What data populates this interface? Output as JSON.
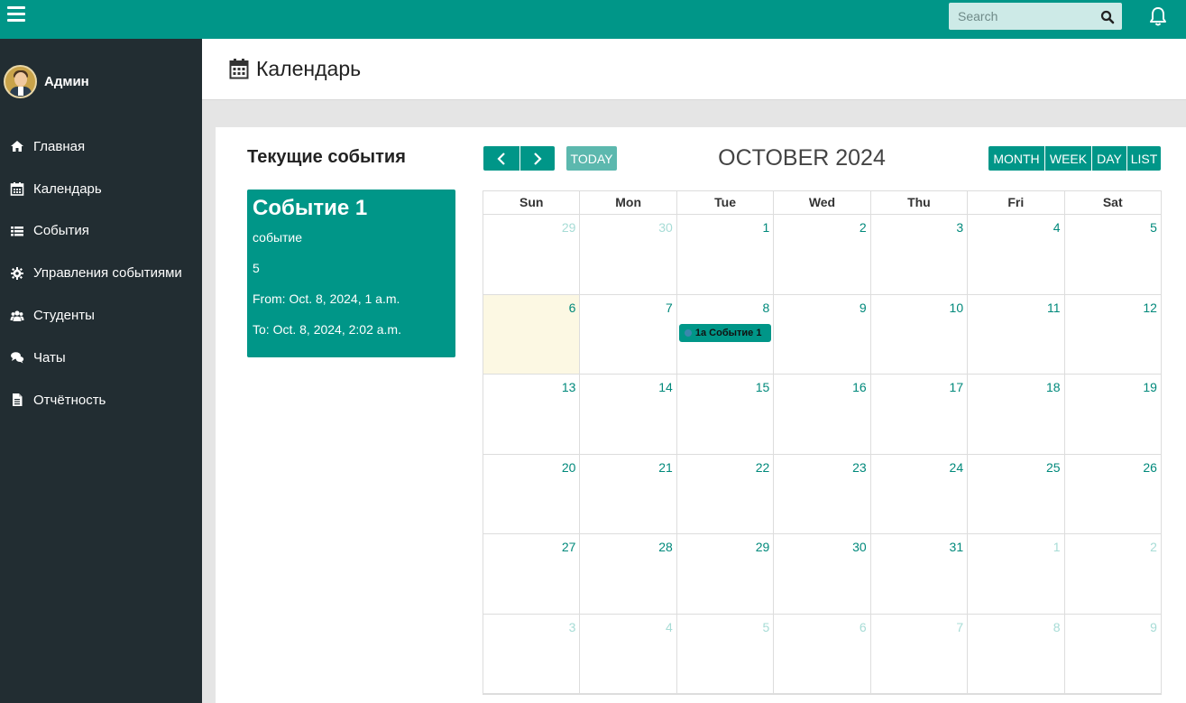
{
  "topbar": {
    "search_placeholder": "Search",
    "menu_icon": "hamburger-icon",
    "search_icon": "search-icon",
    "notifications_icon": "bell-icon",
    "color": "#009688"
  },
  "sidebar": {
    "user_name": "Админ",
    "items": [
      {
        "label": "Главная",
        "icon": "home-icon"
      },
      {
        "label": "Календарь",
        "icon": "calendar-icon"
      },
      {
        "label": "События",
        "icon": "list-icon"
      },
      {
        "label": "Управления событиями",
        "icon": "gear-icon"
      },
      {
        "label": "Студенты",
        "icon": "users-icon"
      },
      {
        "label": "Чаты",
        "icon": "chat-icon"
      },
      {
        "label": "Отчётность",
        "icon": "document-icon"
      }
    ]
  },
  "header": {
    "title": "Календарь",
    "icon": "calendar-icon"
  },
  "current_events": {
    "title": "Текущие события",
    "events": [
      {
        "title": "Событие 1",
        "description": "событие",
        "number": "5",
        "from": "From: Oct. 8, 2024, 1 a.m.",
        "to": "To: Oct. 8, 2024, 2:02 a.m."
      }
    ]
  },
  "calendar": {
    "title": "OCTOBER 2024",
    "today_label": "TODAY",
    "view_buttons": [
      "MONTH",
      "WEEK",
      "DAY",
      "LIST"
    ],
    "weekdays": [
      "Sun",
      "Mon",
      "Tue",
      "Wed",
      "Thu",
      "Fri",
      "Sat"
    ],
    "weeks": [
      [
        "29",
        "30",
        "1",
        "2",
        "3",
        "4",
        "5"
      ],
      [
        "6",
        "7",
        "8",
        "9",
        "10",
        "11",
        "12"
      ],
      [
        "13",
        "14",
        "15",
        "16",
        "17",
        "18",
        "19"
      ],
      [
        "20",
        "21",
        "22",
        "23",
        "24",
        "25",
        "26"
      ],
      [
        "27",
        "28",
        "29",
        "30",
        "31",
        "1",
        "2"
      ],
      [
        "3",
        "4",
        "5",
        "6",
        "7",
        "8",
        "9"
      ]
    ],
    "event": {
      "time": "1a",
      "title": "Событие 1"
    },
    "colors": {
      "accent": "#009688",
      "today_bg": "#fcf8e3",
      "day_number": "#00897b",
      "other_month_number": "#a7dcd6"
    }
  }
}
